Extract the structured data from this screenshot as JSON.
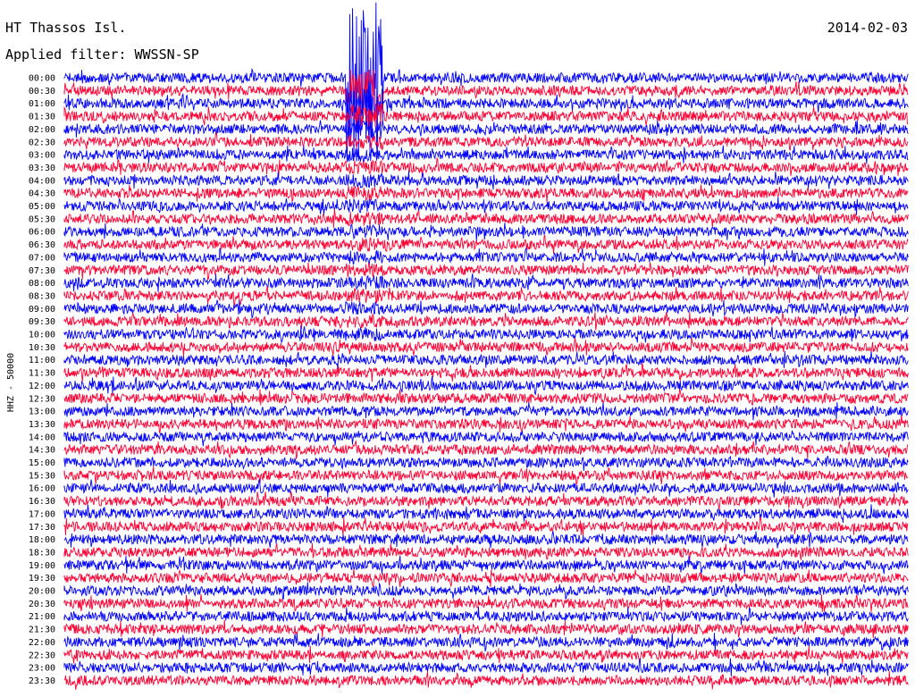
{
  "header": {
    "station": "HT Thassos Isl.",
    "date": "2014-02-03",
    "filter": "Applied filter: WWSSN-SP"
  },
  "chart_data": {
    "type": "line",
    "title": "HT Thassos Isl.",
    "subtitle": "Applied filter: WWSSN-SP",
    "date": "2014-02-03",
    "ylabel": "HHZ - 50000",
    "xlabel": "",
    "row_labels": [
      "00:00",
      "00:30",
      "01:00",
      "01:30",
      "02:00",
      "02:30",
      "03:00",
      "03:30",
      "04:00",
      "04:30",
      "05:00",
      "05:30",
      "06:00",
      "06:30",
      "07:00",
      "07:30",
      "08:00",
      "08:30",
      "09:00",
      "09:30",
      "10:00",
      "10:30",
      "11:00",
      "11:30",
      "12:00",
      "12:30",
      "13:00",
      "13:30",
      "14:00",
      "14:30",
      "15:00",
      "15:30",
      "16:00",
      "16:30",
      "17:00",
      "17:30",
      "18:00",
      "18:30",
      "19:00",
      "19:30",
      "20:00",
      "20:30",
      "21:00",
      "21:30",
      "22:00",
      "22:30",
      "23:00",
      "23:30"
    ],
    "row_duration_minutes": 30,
    "series_colors": [
      "#0000ff",
      "#ff0033"
    ],
    "event": {
      "first_row": "00:00",
      "last_row": "10:00",
      "minute_start": 10.0,
      "minute_end": 11.3
    },
    "grid": false
  }
}
